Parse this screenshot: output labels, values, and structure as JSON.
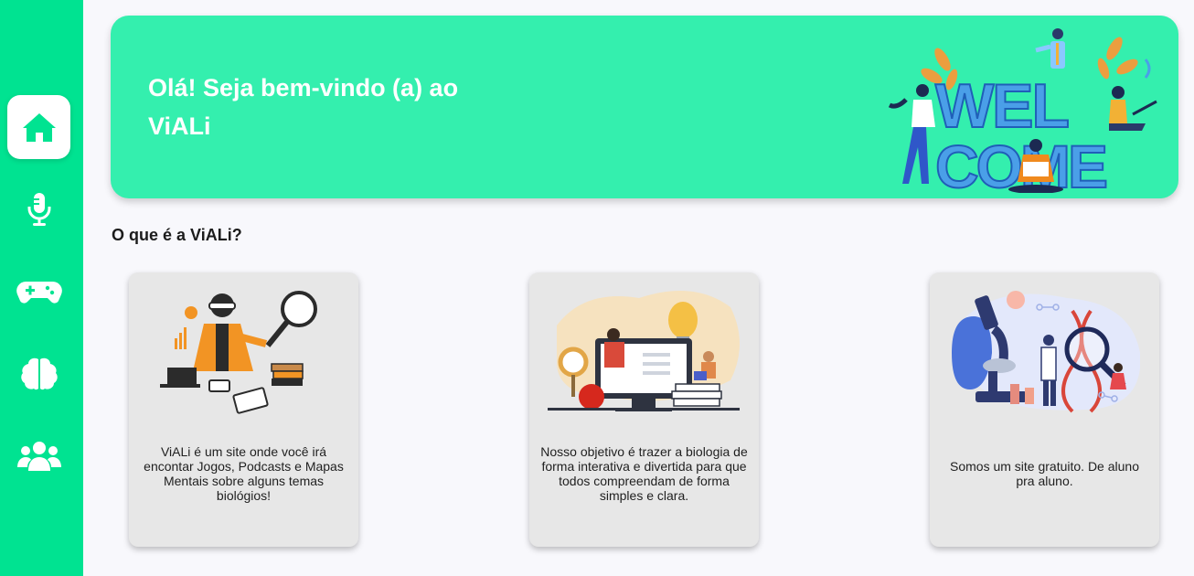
{
  "sidebar": {
    "items": [
      {
        "icon": "home-icon",
        "active": true
      },
      {
        "icon": "microphone-icon",
        "active": false
      },
      {
        "icon": "gamepad-icon",
        "active": false
      },
      {
        "icon": "brain-icon",
        "active": false
      },
      {
        "icon": "users-icon",
        "active": false
      }
    ]
  },
  "banner": {
    "title_line1": "Olá! Seja bem-vindo (a) ao",
    "title_line2": "ViALi",
    "illustration_text_line1": "WEL",
    "illustration_text_line2": "COME"
  },
  "section": {
    "title": "O que é a ViALi?"
  },
  "cards": [
    {
      "illustration": "researcher-with-magnifier",
      "text": "ViALi é um site onde você irá encontar Jogos, Podcasts e Mapas Mentais sobre alguns temas biológios!"
    },
    {
      "illustration": "teacher-online-lesson",
      "text": "Nosso objetivo é trazer a biologia de forma interativa e divertida para que todos compreendam de forma simples e clara."
    },
    {
      "illustration": "laboratory-science",
      "text": "Somos um site gratuito. De aluno pra aluno."
    }
  ],
  "colors": {
    "sidebar": "#00e391",
    "banner": "#34efae",
    "card": "#e7e7e7",
    "background": "#f8f8fc"
  }
}
